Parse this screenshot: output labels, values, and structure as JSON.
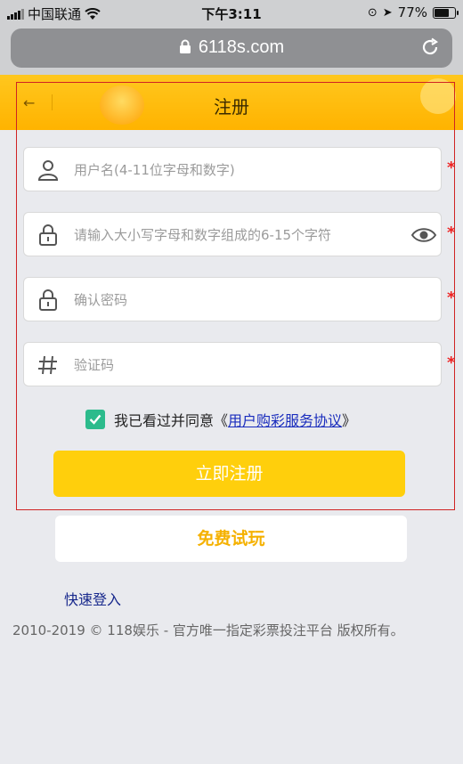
{
  "status_bar": {
    "carrier": "中国联通",
    "time": "下午3:11",
    "battery": "77%",
    "battery_level": 0.77
  },
  "browser": {
    "url": "6118s.com"
  },
  "header": {
    "title": "注册",
    "back_icon": "←"
  },
  "form": {
    "username_placeholder": "用户名(4-11位字母和数字)",
    "password_placeholder": "请输入大小写字母和数字组成的6-15个字符",
    "confirm_placeholder": "确认密码",
    "captcha_placeholder": "验证码",
    "required_mark": "*",
    "agree_text": "我已看过并同意《",
    "agree_link": "用户购彩服务协议",
    "agree_close": "》",
    "agree_checked": true,
    "register_button": "立即注册"
  },
  "trial_button": "免费试玩",
  "quick_login": "快速登入",
  "footer": "2010-2019 © 118娱乐 - 官方唯一指定彩票投注平台 版权所有。",
  "colors": {
    "accent": "#ffcf0c",
    "checkbox": "#2cbb8c",
    "link": "#1a2dbd",
    "required": "#e22222"
  }
}
